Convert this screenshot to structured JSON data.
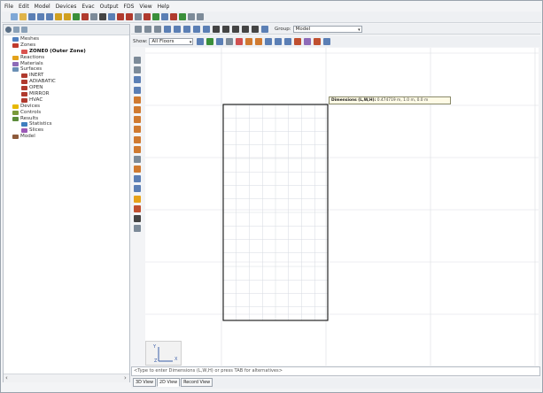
{
  "menu": [
    "File",
    "Edit",
    "Model",
    "Devices",
    "Evac",
    "Output",
    "FDS",
    "View",
    "Help"
  ],
  "tree": [
    {
      "label": "Meshes",
      "indent": 1,
      "icon": "mesh-icon",
      "color": "#4f7fbf"
    },
    {
      "label": "Zones",
      "indent": 1,
      "icon": "zones-icon",
      "color": "#c0392b"
    },
    {
      "label": "ZONE0 (Outer Zone)",
      "indent": 2,
      "icon": "zone-icon",
      "color": "#d9534f",
      "selected": true
    },
    {
      "label": "Reactions",
      "indent": 1,
      "icon": "reactions-icon",
      "color": "#e3a21a"
    },
    {
      "label": "Materials",
      "indent": 1,
      "icon": "materials-icon",
      "color": "#8e6bb8"
    },
    {
      "label": "Surfaces",
      "indent": 1,
      "icon": "surfaces-icon",
      "color": "#6a8fb5"
    },
    {
      "label": "INERT",
      "indent": 2,
      "icon": "surface-icon",
      "color": "#b03a2e"
    },
    {
      "label": "ADIABATIC",
      "indent": 2,
      "icon": "surface-icon",
      "color": "#b03a2e"
    },
    {
      "label": "OPEN",
      "indent": 2,
      "icon": "surface-icon",
      "color": "#b03a2e"
    },
    {
      "label": "MIRROR",
      "indent": 2,
      "icon": "surface-icon",
      "color": "#b03a2e"
    },
    {
      "label": "HVAC",
      "indent": 2,
      "icon": "surface-icon",
      "color": "#b03a2e"
    },
    {
      "label": "Devices",
      "indent": 1,
      "icon": "devices-icon",
      "color": "#e6b800"
    },
    {
      "label": "Controls",
      "indent": 1,
      "icon": "controls-icon",
      "color": "#7a9a3a"
    },
    {
      "label": "Results",
      "indent": 1,
      "icon": "results-icon",
      "color": "#5b8c3a"
    },
    {
      "label": "Statistics",
      "indent": 2,
      "icon": "statistics-icon",
      "color": "#3f7fbf"
    },
    {
      "label": "Slices",
      "indent": 2,
      "icon": "slices-icon",
      "color": "#9b59b6"
    },
    {
      "label": "Model",
      "indent": 1,
      "icon": "model-icon",
      "color": "#8d5a3b"
    }
  ],
  "view_toolbar": {
    "group_label": "Group:",
    "group_value": "Model"
  },
  "show_bar": {
    "label": "Show:",
    "value": "All Floors"
  },
  "tooltip": {
    "title": "Dimensions (L,W,H):",
    "value": "0.474719 m, 1.0 m, 0.0 m"
  },
  "status_text": "<Type to enter Dimensions (L,W,H) or press TAB for alternatives>",
  "tabs": [
    "3D View",
    "2D View",
    "Record View"
  ],
  "active_tab": 1,
  "axis": {
    "y": "Y",
    "x": "X",
    "z": "Z"
  },
  "scroll": {
    "left_arrow": "‹",
    "right_arrow": "›"
  }
}
